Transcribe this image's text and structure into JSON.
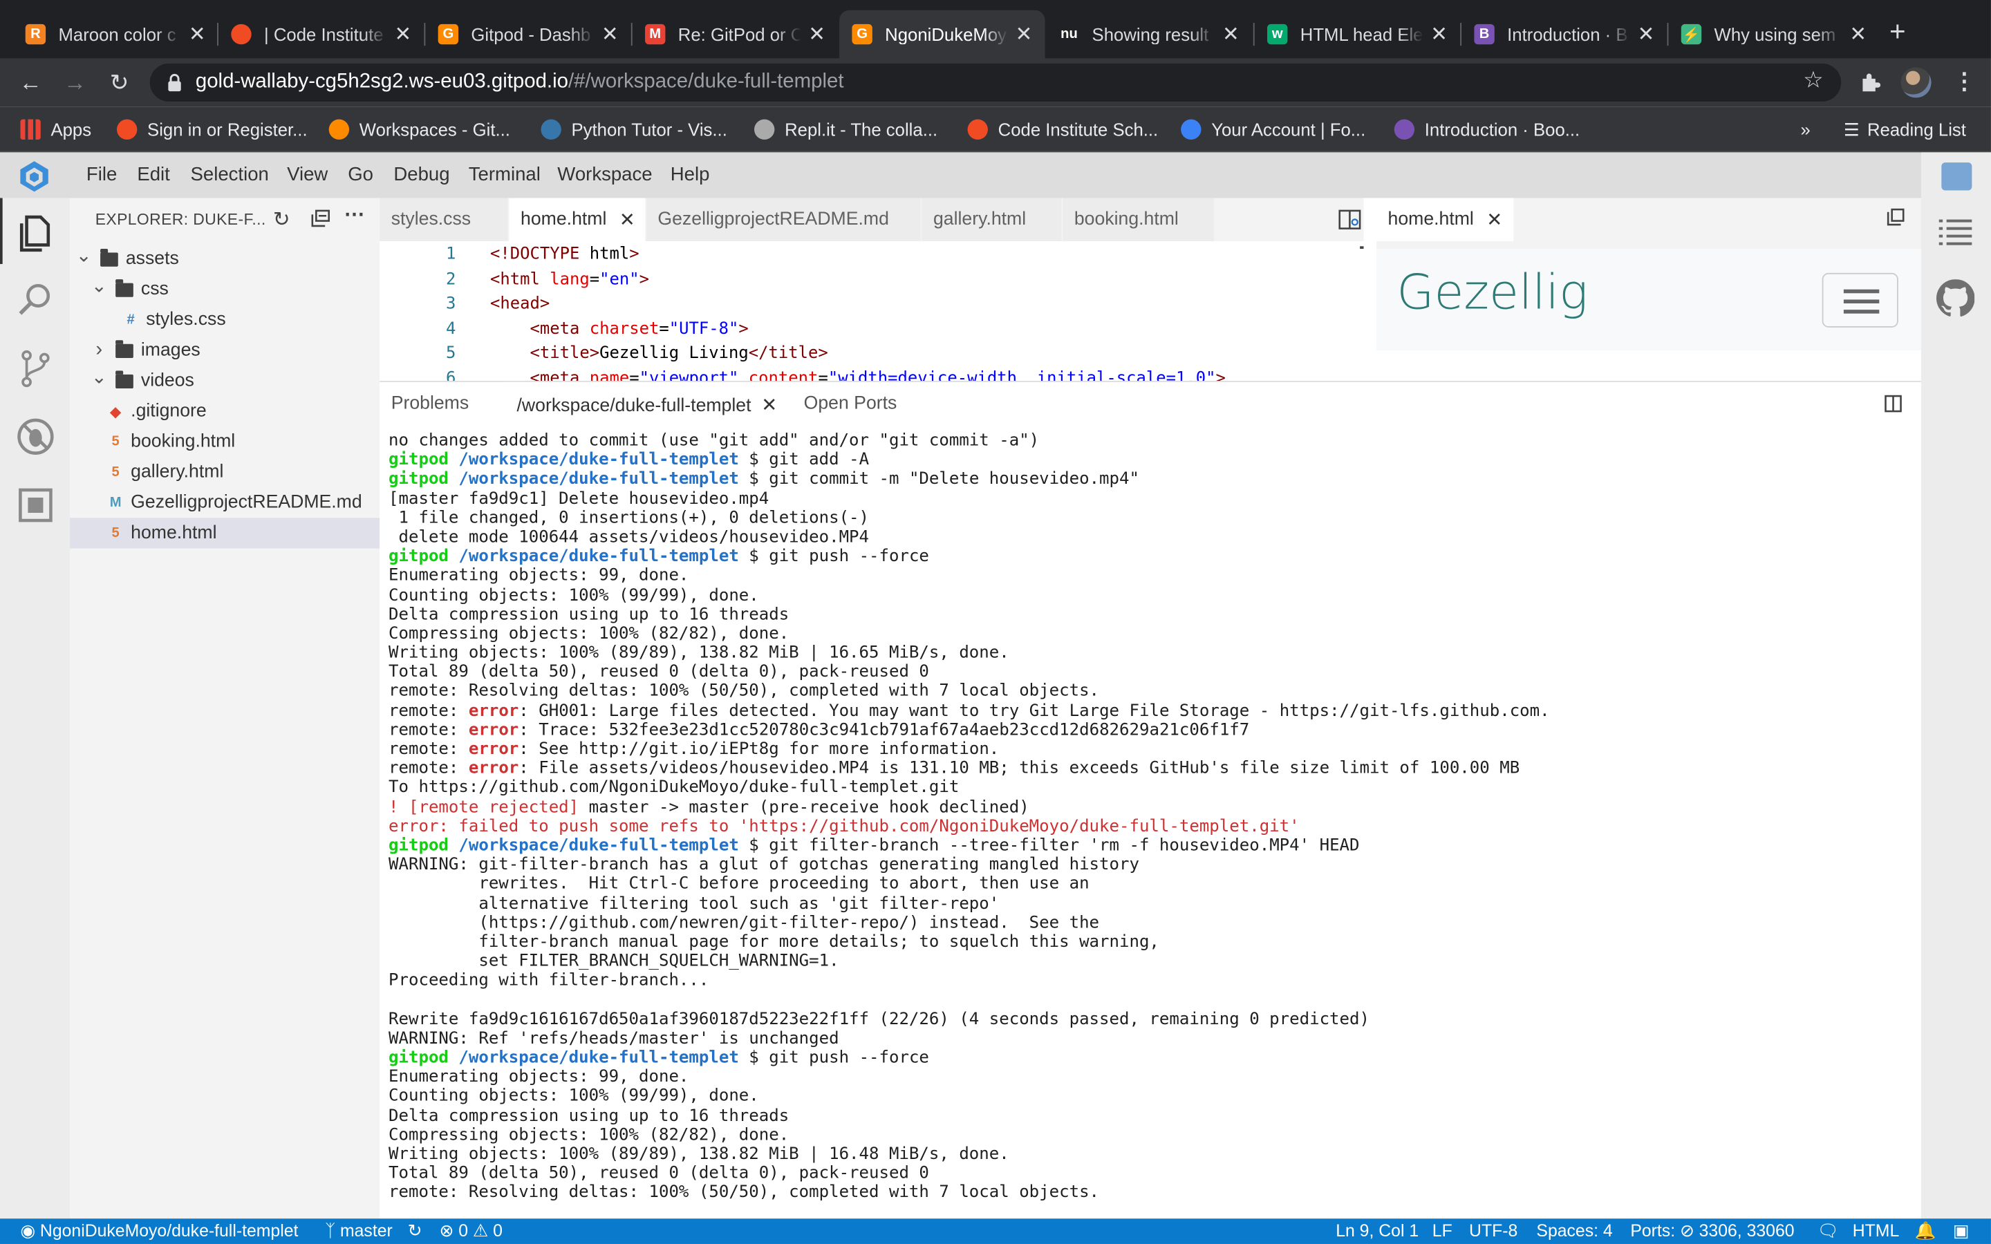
{
  "browser": {
    "tabs": [
      {
        "title": "Maroon color c",
        "icon": "R",
        "color": "#f58220"
      },
      {
        "title": "| Code Institute",
        "icon": "",
        "color": "#f04b23"
      },
      {
        "title": "Gitpod - Dashb",
        "icon": "G",
        "color": "#ff8a00"
      },
      {
        "title": "Re: GitPod or C",
        "icon": "M",
        "color": "#ea4335"
      },
      {
        "title": "NgoniDukeMoy",
        "icon": "G",
        "color": "#ff8a00"
      },
      {
        "title": "Showing result",
        "icon": "nu",
        "color": "#202124"
      },
      {
        "title": "HTML head Ele",
        "icon": "w",
        "color": "#04aa6d"
      },
      {
        "title": "Introduction · B",
        "icon": "B",
        "color": "#7952b3"
      },
      {
        "title": "Why using sem",
        "icon": "⚡",
        "color": "#41b883"
      }
    ],
    "url_host": "gold-wallaby-cg5h2sg2.ws-eu03.gitpod.io",
    "url_path": "/#/workspace/duke-full-templet",
    "bookmarks": [
      "Apps",
      "Sign in or Register...",
      "Workspaces - Git...",
      "Python Tutor - Vis...",
      "Repl.it - The colla...",
      "Code Institute Sch...",
      "Your Account | Fo...",
      "Introduction · Boo..."
    ],
    "reading_list": "Reading List",
    "more": "»"
  },
  "ide": {
    "menu": [
      "File",
      "Edit",
      "Selection",
      "View",
      "Go",
      "Debug",
      "Terminal",
      "Workspace",
      "Help"
    ],
    "explorer_title": "EXPLORER: DUKE-F...",
    "tree": [
      {
        "label": "assets",
        "type": "folder",
        "open": true,
        "depth": 0
      },
      {
        "label": "css",
        "type": "folder",
        "open": true,
        "depth": 1
      },
      {
        "label": "styles.css",
        "type": "css",
        "depth": 2
      },
      {
        "label": "images",
        "type": "folder",
        "open": false,
        "depth": 1
      },
      {
        "label": "videos",
        "type": "folder",
        "open": true,
        "depth": 1
      },
      {
        "label": ".gitignore",
        "type": "git",
        "depth": 1
      },
      {
        "label": "booking.html",
        "type": "html",
        "depth": 1
      },
      {
        "label": "gallery.html",
        "type": "html",
        "depth": 1
      },
      {
        "label": "GezelligprojectREADME.md",
        "type": "md",
        "depth": 1
      },
      {
        "label": "home.html",
        "type": "html",
        "depth": 1,
        "selected": true
      }
    ],
    "editor_tabs": [
      "styles.css",
      "home.html",
      "GezelligprojectREADME.md",
      "gallery.html",
      "booking.html"
    ],
    "active_editor_tab": "home.html",
    "code_lines": [
      {
        "n": "1",
        "text": "<!DOCTYPE html>"
      },
      {
        "n": "2",
        "text": "<html lang=\"en\">"
      },
      {
        "n": "3",
        "text": "<head>"
      },
      {
        "n": "4",
        "text": "    <meta charset=\"UTF-8\">"
      },
      {
        "n": "5",
        "text": "    <title>Gezellig Living</title>"
      },
      {
        "n": "6",
        "text": "    <meta name=\"viewport\" content=\"width=device-width, initial-scale=1.0\">"
      }
    ],
    "preview_tab": "home.html",
    "preview_brand": "Gezellig",
    "panel_tabs": [
      "Problems",
      "/workspace/duke-full-templet",
      "Open Ports"
    ],
    "terminal": [
      "no changes added to commit (use \"git add\" and/or \"git commit -a\")",
      "$P git add -A",
      "$P git commit -m \"Delete housevideo.mp4\"",
      "[master fa9d9c1] Delete housevideo.mp4",
      " 1 file changed, 0 insertions(+), 0 deletions(-)",
      " delete mode 100644 assets/videos/housevideo.MP4",
      "$P git push --force",
      "Enumerating objects: 99, done.",
      "Counting objects: 100% (99/99), done.",
      "Delta compression using up to 16 threads",
      "Compressing objects: 100% (82/82), done.",
      "Writing objects: 100% (89/89), 138.82 MiB | 16.65 MiB/s, done.",
      "Total 89 (delta 50), reused 0 (delta 0), pack-reused 0",
      "remote: Resolving deltas: 100% (50/50), completed with 7 local objects.",
      "$E GH001: Large files detected. You may want to try Git Large File Storage - https://git-lfs.github.com.",
      "$E Trace: 532fee3e23d1cc520780c3c941cb791af67a4aeb23ccd12d682629a21c06f1f7",
      "$E See http://git.io/iEPt8g for more information.",
      "$E File assets/videos/housevideo.MP4 is 131.10 MB; this exceeds GitHub's file size limit of 100.00 MB",
      "To https://github.com/NgoniDukeMoyo/duke-full-templet.git",
      "$R ! [remote rejected] master -> master (pre-receive hook declined)",
      "$X error: failed to push some refs to 'https://github.com/NgoniDukeMoyo/duke-full-templet.git'",
      "$P git filter-branch --tree-filter 'rm -f housevideo.MP4' HEAD",
      "WARNING: git-filter-branch has a glut of gotchas generating mangled history",
      "         rewrites.  Hit Ctrl-C before proceeding to abort, then use an",
      "         alternative filtering tool such as 'git filter-repo'",
      "         (https://github.com/newren/git-filter-repo/) instead.  See the",
      "         filter-branch manual page for more details; to squelch this warning,",
      "         set FILTER_BRANCH_SQUELCH_WARNING=1.",
      "Proceeding with filter-branch...",
      "",
      "Rewrite fa9d9c1616167d650a1af3960187d5223e22f1ff (22/26) (4 seconds passed, remaining 0 predicted)",
      "WARNING: Ref 'refs/heads/master' is unchanged",
      "$P git push --force",
      "Enumerating objects: 99, done.",
      "Counting objects: 100% (99/99), done.",
      "Delta compression using up to 16 threads",
      "Compressing objects: 100% (82/82), done.",
      "Writing objects: 100% (89/89), 138.82 MiB | 16.48 MiB/s, done.",
      "Total 89 (delta 50), reused 0 (delta 0), pack-reused 0",
      "remote: Resolving deltas: 100% (50/50), completed with 7 local objects."
    ],
    "prompt_user": "gitpod",
    "prompt_path": "/workspace/duke-full-templet",
    "prompt_symbol": "$",
    "remote_label": "remote:",
    "error_label": "error"
  },
  "status": {
    "repo": "NgoniDukeMoyo/duke-full-templet",
    "branch": "master",
    "errors": "0",
    "warnings": "0",
    "position": "Ln 9, Col 1",
    "eol": "LF",
    "encoding": "UTF-8",
    "spaces": "Spaces: 4",
    "ports": "Ports: ⊘ 3306, 33060",
    "language": "HTML"
  },
  "colors": {
    "status_bar": "#0a7acc",
    "prompt_user": "#14ce14",
    "prompt_path": "#2472c8",
    "error": "#cd3131"
  }
}
